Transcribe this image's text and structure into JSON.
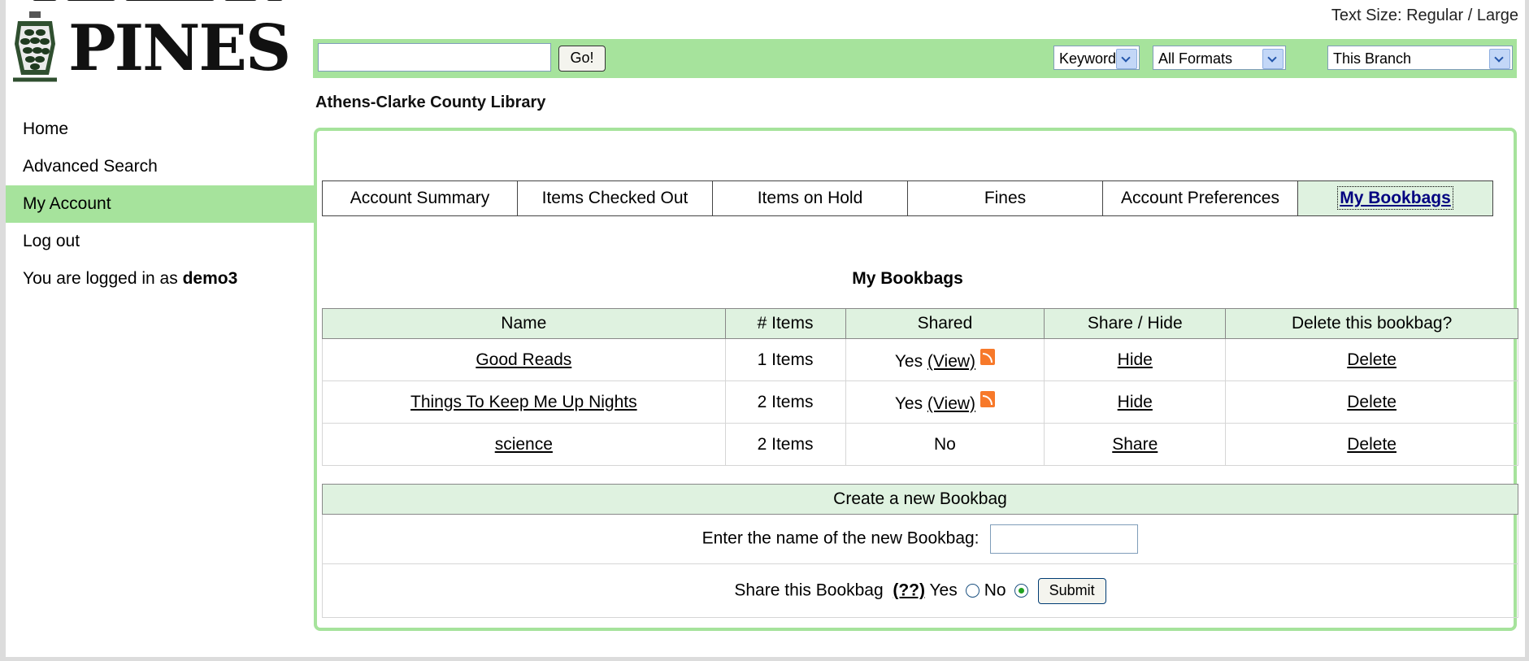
{
  "brand": {
    "logo_text": "PINES",
    "logo_icon": "pinecone-icon"
  },
  "text_size": {
    "label": "Text Size:",
    "regular": "Regular",
    "sep": "/",
    "large": "Large"
  },
  "sidebar": {
    "items": [
      {
        "label": "Home"
      },
      {
        "label": "Advanced Search"
      },
      {
        "label": "My Account"
      },
      {
        "label": "Log out"
      }
    ],
    "logged_in_prefix": "You are logged in as",
    "username": "demo3"
  },
  "search": {
    "query": "",
    "go_label": "Go!",
    "type": "Keyword",
    "format": "All Formats",
    "scope": "This Branch"
  },
  "branch_name": "Athens-Clarke County Library",
  "tabs": [
    {
      "label": "Account Summary"
    },
    {
      "label": "Items Checked Out"
    },
    {
      "label": "Items on Hold"
    },
    {
      "label": "Fines"
    },
    {
      "label": "Account Preferences"
    },
    {
      "label": "My Bookbags"
    }
  ],
  "bookbags": {
    "title": "My Bookbags",
    "headers": [
      "Name",
      "# Items",
      "Shared",
      "Share / Hide",
      "Delete this bookbag?"
    ],
    "rows": [
      {
        "name": "Good Reads",
        "items": "1 Items",
        "shared": "Yes",
        "view": "(View)",
        "action": "Hide",
        "delete": "Delete"
      },
      {
        "name": "Things To Keep Me Up Nights",
        "items": "2 Items",
        "shared": "Yes",
        "view": "(View)",
        "action": "Hide",
        "delete": "Delete"
      },
      {
        "name": "science",
        "items": "2 Items",
        "shared": "No",
        "view": "",
        "action": "Share",
        "delete": "Delete"
      }
    ]
  },
  "create": {
    "header": "Create a new Bookbag",
    "name_label": "Enter the name of the new Bookbag:",
    "share_label": "Share this Bookbag",
    "help": "(??)",
    "yes": "Yes",
    "no": "No",
    "submit": "Submit"
  },
  "colors": {
    "accent_green": "#a6e39c",
    "header_green": "#dff2e0",
    "active_tab_text": "#000080",
    "rss_orange": "#f7792a"
  }
}
